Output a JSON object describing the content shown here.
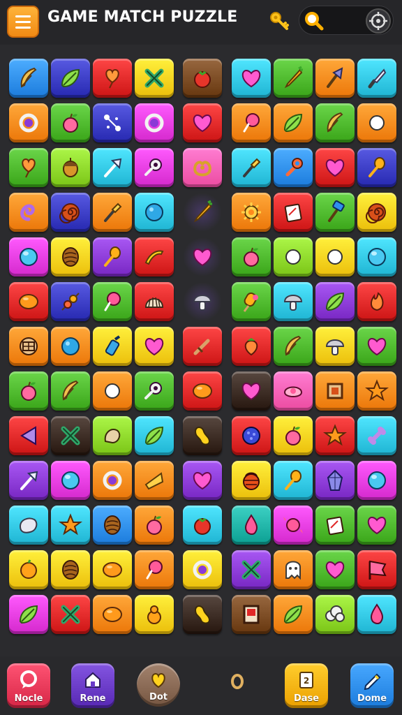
{
  "header": {
    "title": "GAME MATCH PUZZLE",
    "menu_icon": "menu-icon",
    "key_icon": "key-icon",
    "search_icon": "search-icon",
    "target_icon": "target-icon"
  },
  "palette": {
    "blue": "#2f8ff0",
    "navy": "#3a3cc4",
    "red": "#e02828",
    "yellow": "#ffd21e",
    "brown": "#7a4a22",
    "pink": "#ff5fb4",
    "green": "#4db82c",
    "orange": "#ff8a1c",
    "cyan": "#32c8e6",
    "lime": "#8ed82a",
    "purple": "#8b3ad6",
    "magenta": "#e83ce0",
    "dark": "#3a2a22",
    "teal": "#1fb3a6",
    "darkgreen": "#1f7a22"
  },
  "grid": {
    "rows": [
      [
        "blue:feather",
        "navy:leaf",
        "red:heart-balloon",
        "yellow:cross",
        "brown:tomato",
        "",
        "cyan:heart",
        "green:carrot",
        "orange:pick",
        "cyan:knife"
      ],
      [
        "orange:ring",
        "green:apple",
        "navy:sparkle",
        "magenta:ring",
        "red:heart",
        "",
        "orange:lollipop",
        "orange:leaf",
        "green:feather",
        "orange:shield"
      ],
      [
        "green:heart-balloon",
        "lime:acorn",
        "cyan:arrow",
        "magenta:key",
        "pink:pretzel",
        "",
        "cyan:brush",
        "blue:wrench",
        "red:heart",
        "navy:spoon"
      ],
      [
        "orange:swirl",
        "navy:spiral",
        "orange:brush",
        "cyan:ball",
        "empty:carrot",
        "",
        "orange:gear",
        "red:card",
        "green:hammer",
        "yellow:spiral"
      ],
      [
        "magenta:orb",
        "yellow:nut",
        "purple:spoon",
        "red:boomerang",
        "empty:heart",
        "",
        "green:apple",
        "lime:flower",
        "yellow:gem",
        "cyan:orb"
      ],
      [
        "red:lemon",
        "navy:skewer",
        "green:lollipop",
        "red:shell",
        "empty:mushroom",
        "",
        "green:popsicle",
        "cyan:mushroom",
        "purple:leaf",
        "red:flame"
      ],
      [
        "orange:cookie",
        "orange:ball",
        "yellow:bottle",
        "yellow:heart",
        "red:sword",
        "",
        "red:strawberry",
        "green:feather",
        "yellow:mushroom",
        "green:heart"
      ],
      [
        "green:apple",
        "green:feather",
        "orange:bag",
        "green:key",
        "red:lemon",
        "",
        "dark:heart",
        "pink:bun",
        "orange:frame",
        "orange:star"
      ],
      [
        "red:triangle",
        "dark:cross",
        "lime:potato",
        "cyan:leaf",
        "dark:peanut",
        "",
        "red:berry",
        "yellow:apple",
        "red:star",
        "cyan:bone"
      ],
      [
        "purple:arrow",
        "magenta:orb",
        "orange:ring",
        "orange:cheese",
        "purple:heart",
        "",
        "yellow:basket",
        "cyan:spoon",
        "purple:crystal",
        "magenta:orb"
      ],
      [
        "cyan:rock",
        "cyan:star",
        "blue:nut",
        "orange:apple",
        "cyan:tomato",
        "",
        "teal:drop",
        "magenta:candy",
        "green:card",
        "green:heart"
      ],
      [
        "yellow:orange",
        "yellow:nut",
        "yellow:lemon",
        "orange:lollipop",
        "yellow:ring",
        "",
        "purple:cross",
        "orange:ghost",
        "green:heart",
        "red:flag"
      ],
      [
        "magenta:leaf",
        "red:cross",
        "orange:lemon",
        "yellow:gourd",
        "dark:peanut",
        "",
        "brown:box",
        "orange:leaf",
        "lime:cloud",
        "cyan:drop"
      ]
    ]
  },
  "bottom_nav": [
    {
      "label": "Nocle",
      "icon": "chat-icon",
      "color": "#ea3a5a"
    },
    {
      "label": "Rene",
      "icon": "home-icon",
      "color": "#6b3cc8"
    },
    {
      "label": "Dot",
      "icon": "heart-icon",
      "color": "#8a6a55"
    },
    {
      "label": "Dase",
      "icon": "card-icon",
      "color": "#ffb414"
    },
    {
      "label": "Dome",
      "icon": "pencil-icon",
      "color": "#2f8ff0"
    }
  ]
}
